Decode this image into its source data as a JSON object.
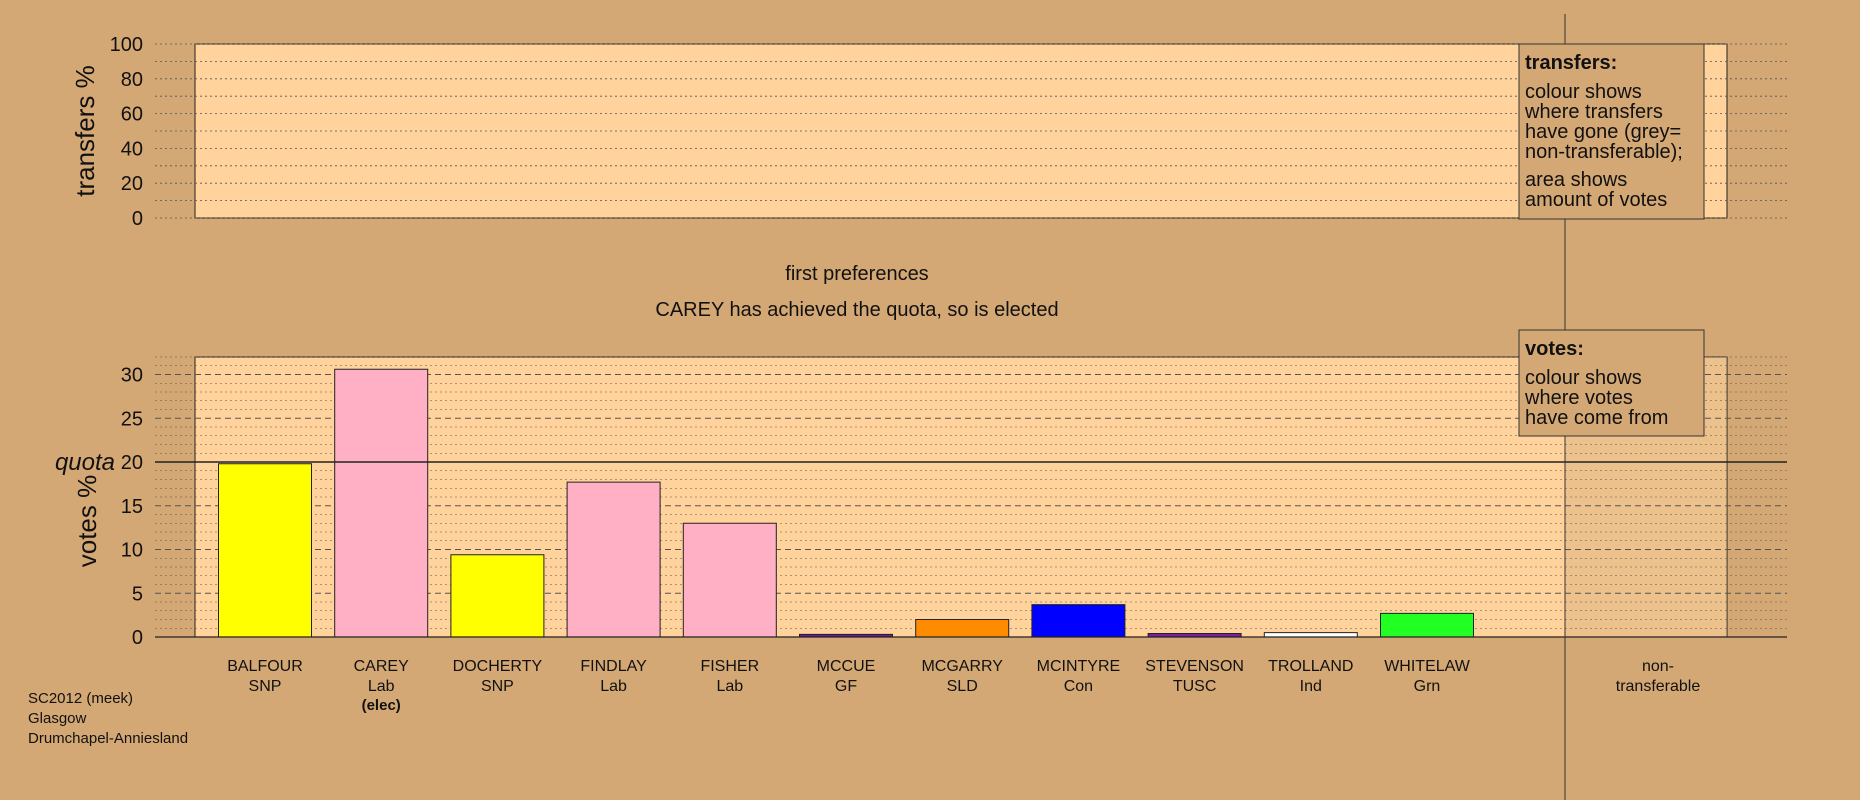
{
  "chart_data": [
    {
      "type": "bar",
      "panel": "transfers",
      "ylabel": "transfers %",
      "ylim": [
        0,
        100
      ],
      "yticks": [
        0,
        20,
        40,
        60,
        80,
        100
      ],
      "grid": true,
      "series": [],
      "legend": {
        "title": "transfers:",
        "lines": [
          "colour shows",
          "where transfers",
          "have gone (grey=",
          "non-transferable);",
          "area shows",
          "amount of votes"
        ]
      }
    },
    {
      "type": "bar",
      "panel": "votes",
      "title": "first preferences",
      "subtitle": "CAREY has achieved the quota, so is elected",
      "ylabel": "votes %",
      "ylim": [
        0,
        32
      ],
      "yticks": [
        0,
        5,
        10,
        15,
        20,
        25,
        30
      ],
      "quota": {
        "label": "quota",
        "value": 20
      },
      "grid": true,
      "categories": [
        {
          "name": "BALFOUR",
          "party": "SNP",
          "value": 19.8,
          "color": "#ffff00",
          "note": ""
        },
        {
          "name": "CAREY",
          "party": "Lab",
          "value": 30.6,
          "color": "#ffb0c4",
          "note": "(elec)"
        },
        {
          "name": "DOCHERTY",
          "party": "SNP",
          "value": 9.4,
          "color": "#ffff00",
          "note": ""
        },
        {
          "name": "FINDLAY",
          "party": "Lab",
          "value": 17.7,
          "color": "#ffb0c4",
          "note": ""
        },
        {
          "name": "FISHER",
          "party": "Lab",
          "value": 13.0,
          "color": "#ffb0c4",
          "note": ""
        },
        {
          "name": "MCCUE",
          "party": "GF",
          "value": 0.3,
          "color": "#6a1b9a",
          "note": ""
        },
        {
          "name": "MCGARRY",
          "party": "SLD",
          "value": 2.0,
          "color": "#ff8c00",
          "note": ""
        },
        {
          "name": "MCINTYRE",
          "party": "Con",
          "value": 3.7,
          "color": "#0000ff",
          "note": ""
        },
        {
          "name": "STEVENSON",
          "party": "TUSC",
          "value": 0.4,
          "color": "#7b1fa2",
          "note": ""
        },
        {
          "name": "TROLLAND",
          "party": "Ind",
          "value": 0.5,
          "color": "#ffffff",
          "note": ""
        },
        {
          "name": "WHITELAW",
          "party": "Grn",
          "value": 2.7,
          "color": "#22ff22",
          "note": ""
        }
      ],
      "nontransferable": {
        "line1": "non-",
        "line2": "transferable",
        "value": 0
      },
      "legend": {
        "title": "votes:",
        "lines": [
          "colour shows",
          "where votes",
          "have come from"
        ]
      }
    }
  ],
  "footer": [
    "SC2012 (meek)",
    "Glasgow",
    "Drumchapel-Anniesland"
  ],
  "colors": {
    "background": "#d4a874",
    "plot_area": "#ffd39b",
    "nontransferable_band": "#c9a070",
    "legend_box": "#d4a874"
  }
}
